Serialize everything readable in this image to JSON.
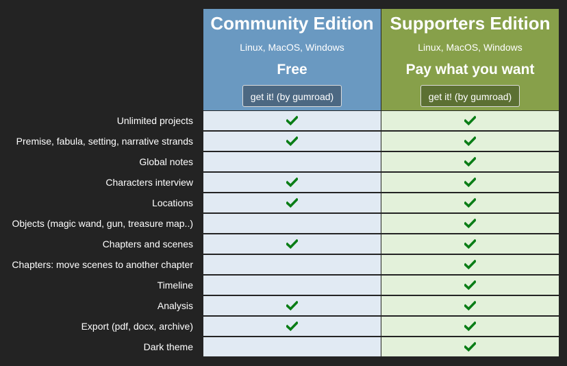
{
  "editions": [
    {
      "title": "Community Edition",
      "platforms": "Linux, MacOS, Windows",
      "price": "Free",
      "button_label": "get it! (by gumroad)",
      "header_color": "#6a99c1",
      "cell_color": "#e1eaf3"
    },
    {
      "title": "Supporters Edition",
      "platforms": "Linux, MacOS, Windows",
      "price": "Pay what you want",
      "button_label": "get it! (by gumroad)",
      "header_color": "#87a04a",
      "cell_color": "#e3f1da"
    }
  ],
  "check_icon": "check-icon",
  "check_color": "#0a7d16",
  "features": [
    {
      "label": "Unlimited projects",
      "community": true,
      "supporters": true
    },
    {
      "label": "Premise, fabula, setting, narrative strands",
      "community": true,
      "supporters": true
    },
    {
      "label": "Global notes",
      "community": false,
      "supporters": true
    },
    {
      "label": "Characters interview",
      "community": true,
      "supporters": true
    },
    {
      "label": "Locations",
      "community": true,
      "supporters": true
    },
    {
      "label": "Objects (magic wand, gun, treasure map..)",
      "community": false,
      "supporters": true
    },
    {
      "label": "Chapters and scenes",
      "community": true,
      "supporters": true
    },
    {
      "label": "Chapters: move scenes to another chapter",
      "community": false,
      "supporters": true
    },
    {
      "label": "Timeline",
      "community": false,
      "supporters": true
    },
    {
      "label": "Analysis",
      "community": true,
      "supporters": true
    },
    {
      "label": "Export (pdf, docx, archive)",
      "community": true,
      "supporters": true
    },
    {
      "label": "Dark theme",
      "community": false,
      "supporters": true
    }
  ]
}
